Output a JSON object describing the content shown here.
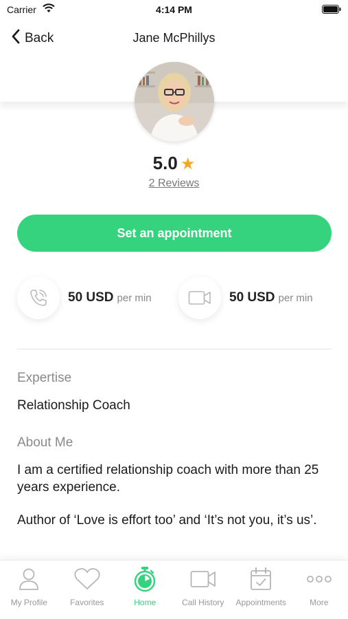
{
  "status_bar": {
    "carrier": "Carrier",
    "time": "4:14 PM"
  },
  "header": {
    "back_label": "Back",
    "title": "Jane McPhillys"
  },
  "profile": {
    "rating": "5.0",
    "reviews_link": "2 Reviews"
  },
  "appointment_button": {
    "label": "Set an appointment"
  },
  "pricing": {
    "voice": {
      "amount": "50 USD",
      "unit": "per min",
      "icon": "phone-icon"
    },
    "video": {
      "amount": "50 USD",
      "unit": "per min",
      "icon": "video-camera-icon"
    }
  },
  "expertise": {
    "label": "Expertise",
    "value": "Relationship Coach"
  },
  "about": {
    "label": "About Me",
    "paragraph1": "I am a certified relationship coach with more than 25 years experience.",
    "paragraph2": "Author of ‘Love is effort too’ and ‘It’s not you, it’s us’."
  },
  "tabs": [
    {
      "label": "My Profile",
      "icon": "person-icon",
      "active": false
    },
    {
      "label": "Favorites",
      "icon": "heart-icon",
      "active": false
    },
    {
      "label": "Home",
      "icon": "stopwatch-icon",
      "active": true
    },
    {
      "label": "Call History",
      "icon": "video-camera-icon",
      "active": false
    },
    {
      "label": "Appointments",
      "icon": "calendar-check-icon",
      "active": false
    },
    {
      "label": "More",
      "icon": "more-dots-icon",
      "active": false
    }
  ],
  "colors": {
    "accent": "#35d37e",
    "star": "#f5a623",
    "muted_text": "#8a8a8a"
  }
}
